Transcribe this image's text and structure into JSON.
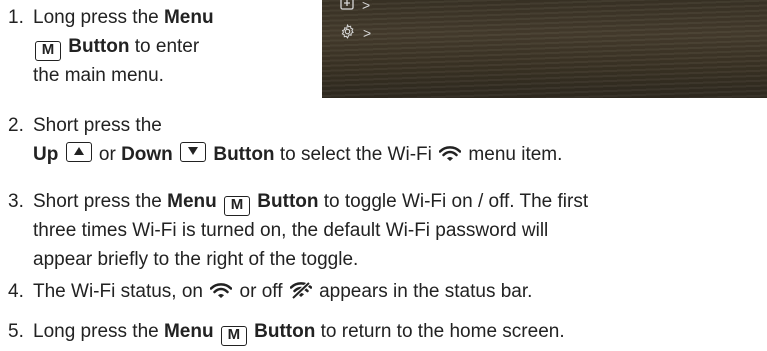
{
  "screen": {
    "items": [
      {
        "icon": "add-box-icon",
        "arrow": ">"
      },
      {
        "icon": "gear-icon",
        "arrow": ">"
      }
    ]
  },
  "steps": [
    {
      "number": "1.",
      "line1": {
        "text": "Long press the ",
        "bold": "Menu"
      },
      "line2": {
        "key": "M",
        "bold": "Button",
        "text": " to enter"
      },
      "line3": "the main menu."
    },
    {
      "number": "2.",
      "line1": "Short press the",
      "line2": {
        "up_bold": "Up",
        "or": " or ",
        "down_bold": "Down",
        "button_bold": "Button",
        "text": " to select the Wi-Fi ",
        "text_end": " menu item."
      }
    },
    {
      "number": "3.",
      "line1": {
        "text": "Short press the ",
        "bold": "Menu",
        "key": "M",
        "bold2": "Button",
        "text2": " to toggle Wi-Fi on / off. The first"
      },
      "line2": "three times Wi-Fi is turned on, the default Wi-Fi password will",
      "line3": "appear briefly to the right of the toggle."
    },
    {
      "number": "4.",
      "line1": {
        "text": "The Wi-Fi status, on ",
        "mid": " or off ",
        "end": " appears in the status bar."
      }
    },
    {
      "number": "5.",
      "line1": {
        "text": "Long press the ",
        "bold": "Menu",
        "key": "M",
        "bold2": "Button",
        "text2": " to return to the home screen."
      }
    }
  ],
  "colors": {
    "text": "#222222",
    "screen_bg": "#3f3729"
  }
}
